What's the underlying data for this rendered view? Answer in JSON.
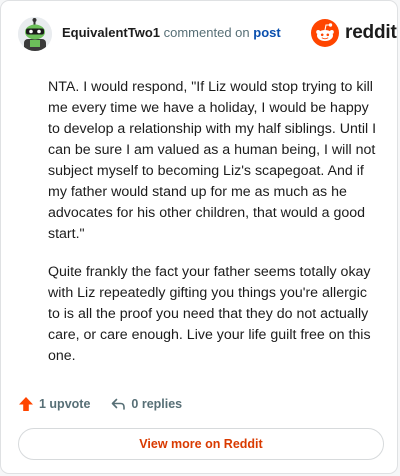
{
  "header": {
    "username": "EquivalentTwo1",
    "commented_on": "commented on",
    "post_link": "post",
    "logo_text": "reddit"
  },
  "comment": {
    "paragraphs": [
      "NTA. I would respond, \"If Liz would stop trying to kill me every time we have a holiday, I would be happy to develop a relationship with my half siblings. Until I can be sure I am valued as a human being, I will not subject myself to becoming Liz's scapegoat. And if my father would stand up for me as much as he advocates for his other children, that would a good start.\"",
      "Quite frankly the fact your father seems totally okay with Liz repeatedly gifting you things you're allergic to is all the proof you need that they do not actually care, or care enough. Live your life guilt free on this one."
    ]
  },
  "actions": {
    "upvotes": "1 upvote",
    "replies": "0 replies"
  },
  "footer": {
    "view_more": "View more on Reddit"
  },
  "colors": {
    "brand": "#ff4500",
    "link": "#0a4fae",
    "view_more": "#d93a00"
  },
  "icons": {
    "upvote": "arrow-up-icon",
    "reply": "reply-arrow-icon",
    "logo": "reddit-snoo-icon",
    "avatar": "snoo-avatar"
  }
}
